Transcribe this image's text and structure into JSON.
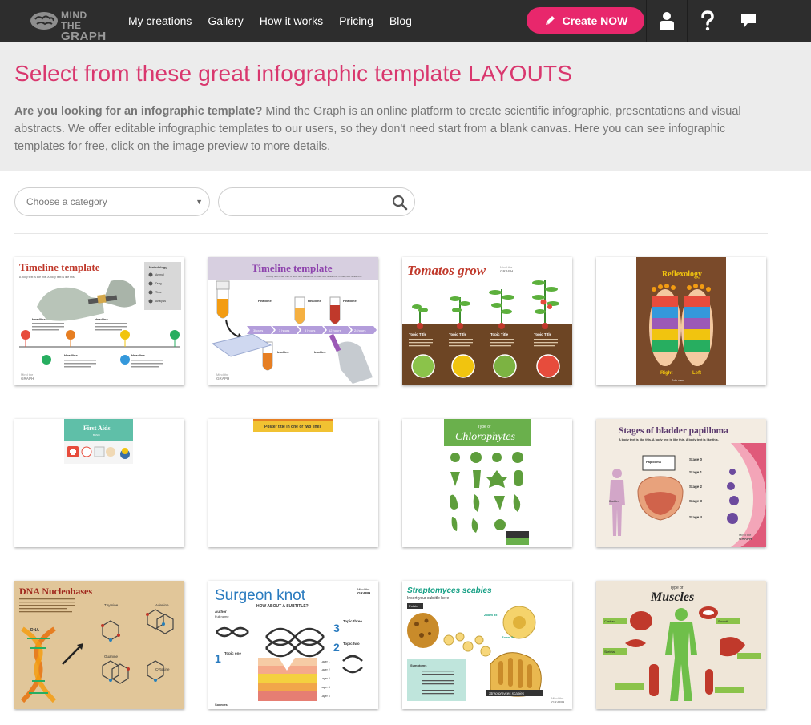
{
  "nav": {
    "logo_line1": "MIND THE",
    "logo_line2": "GRAPH",
    "links": [
      "My creations",
      "Gallery",
      "How it works",
      "Pricing",
      "Blog"
    ],
    "create_label": "Create NOW"
  },
  "hero": {
    "title": "Select from these great infographic template LAYOUTS",
    "desc_bold": "Are you looking for an infographic template?",
    "desc_rest": " Mind the Graph is an online platform to create scientific infographic, presentations and visual abstracts. We offer editable infographic templates to our users, so they don't need start from a blank canvas. Here you can see infographic templates for free, click on the image preview to more details."
  },
  "filters": {
    "category_placeholder": "Choose a category",
    "search_value": ""
  },
  "cards": {
    "c1": {
      "title": "Timeline template",
      "sub": "A body text is like this. A body text is like this.",
      "side_title": "Metodology",
      "side_items": [
        "Animal",
        "Drug",
        "Time",
        "Analysis"
      ],
      "headline": "Headline",
      "brand1": "Mind the",
      "brand2": "GRAPH"
    },
    "c2": {
      "title": "Timeline template",
      "sub": "A body text is like this. A body text is like this. A body text is like this. A body text is like this.",
      "steps": [
        "3hours",
        "3 hours",
        "5 hours",
        "12 hours",
        "24hours"
      ],
      "headline": "Headline",
      "brand1": "Mind the",
      "brand2": "GRAPH"
    },
    "c3": {
      "title": "Tomatos grow",
      "topic": "Topic Title",
      "brand1": "Mind the",
      "brand2": "GRAPH"
    },
    "c4": {
      "title": "Reflexology",
      "right": "Right",
      "left": "Left",
      "foot": "Sole view"
    },
    "c5": {
      "title": "First Aids",
      "sub": "BASIC"
    },
    "c6": {
      "title": "Poster title in one or two lines"
    },
    "c7": {
      "title_small": "Type of",
      "title": "Chlorophytes"
    },
    "c8": {
      "title": "Stages of bladder papilloma",
      "sub": "A body text is like this. A body text is like this. A body text is like this.",
      "stages": [
        "Stage 0",
        "Stage 1",
        "Stage 2",
        "Stage 3",
        "Stage 4"
      ],
      "papilloma": "Papilloma",
      "bladder": "Bladder",
      "brand1": "Mind the",
      "brand2": "GRAPH"
    },
    "c9": {
      "title": "DNA Nucleobases",
      "dna": "DNA",
      "thymine": "Thymine",
      "adenine": "Adenine",
      "guanine": "Guanine",
      "cytosine": "Cytosine"
    },
    "c10": {
      "title": "Surgeon knot",
      "sub": "HOW ABOUT A SUBTITLE?",
      "author": "Author",
      "fullname": "Full name",
      "topics": [
        "Topic one",
        "Topic two",
        "Topic three"
      ],
      "nums": [
        "1",
        "2",
        "3"
      ],
      "layers": [
        "Layer 1",
        "Layer 2",
        "Layer 3",
        "Layer 4",
        "Layer 5"
      ],
      "sources": "Sources:",
      "brand1": "Mind the",
      "brand2": "GRAPH"
    },
    "c11": {
      "title": "Streptomyces scabies",
      "sub": "Insert your subtitle here",
      "potato": "Potato",
      "zoom1": "Zoom 5x",
      "zoom2": "Zoom 5x",
      "label": "Streptomyces scabies",
      "symptoms": "Symptoms",
      "brand1": "Mind the",
      "brand2": "GRAPH"
    },
    "c12": {
      "title_small": "Type of",
      "title": "Muscles",
      "labels": [
        "Cardiac",
        "Smooth",
        "Skeletal"
      ]
    }
  },
  "colors": {
    "accent": "#e8276c",
    "nav_bg": "#2d2d2d",
    "title": "#d9376e"
  }
}
